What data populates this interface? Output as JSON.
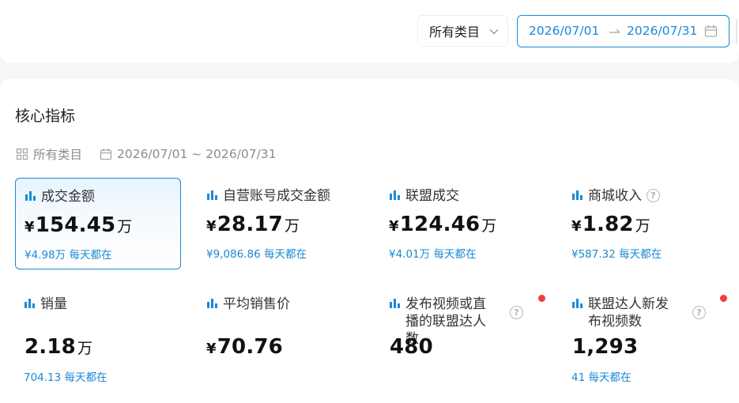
{
  "header": {
    "category_select": "所有类目",
    "date_start": "2026/07/01",
    "date_end": "2026/07/31"
  },
  "section": {
    "title": "核心指标",
    "filter_category": "所有类目",
    "filter_date": "2026/07/01 ~ 2026/07/31"
  },
  "metrics": [
    {
      "label": "成交金额",
      "prefix": "¥",
      "value": "154.45",
      "unit": "万",
      "sub": "¥4.98万 每天都在"
    },
    {
      "label": "自营账号成交金额",
      "prefix": "¥",
      "value": "28.17",
      "unit": "万",
      "sub": "¥9,086.86 每天都在"
    },
    {
      "label": "联盟成交",
      "prefix": "¥",
      "value": "124.46",
      "unit": "万",
      "sub": "¥4.01万 每天都在"
    },
    {
      "label": "商城收入",
      "prefix": "¥",
      "value": "1.82",
      "unit": "万",
      "sub": "¥587.32 每天都在",
      "help": "?"
    },
    {
      "label": "销量",
      "prefix": "",
      "value": "2.18",
      "unit": "万",
      "sub": "704.13 每天都在"
    },
    {
      "label": "平均销售价",
      "prefix": "¥",
      "value": "70.76",
      "unit": "",
      "sub": ""
    },
    {
      "label": "发布视频或直播的联盟达人数",
      "prefix": "",
      "value": "480",
      "unit": "",
      "sub": "",
      "help": "?"
    },
    {
      "label": "联盟达人新发布视频数",
      "prefix": "",
      "value": "1,293",
      "unit": "",
      "sub": "41 每天都在",
      "help": "?"
    }
  ],
  "colors": {
    "accent": "#1a8ad6",
    "badge": "#ef3f3f"
  }
}
